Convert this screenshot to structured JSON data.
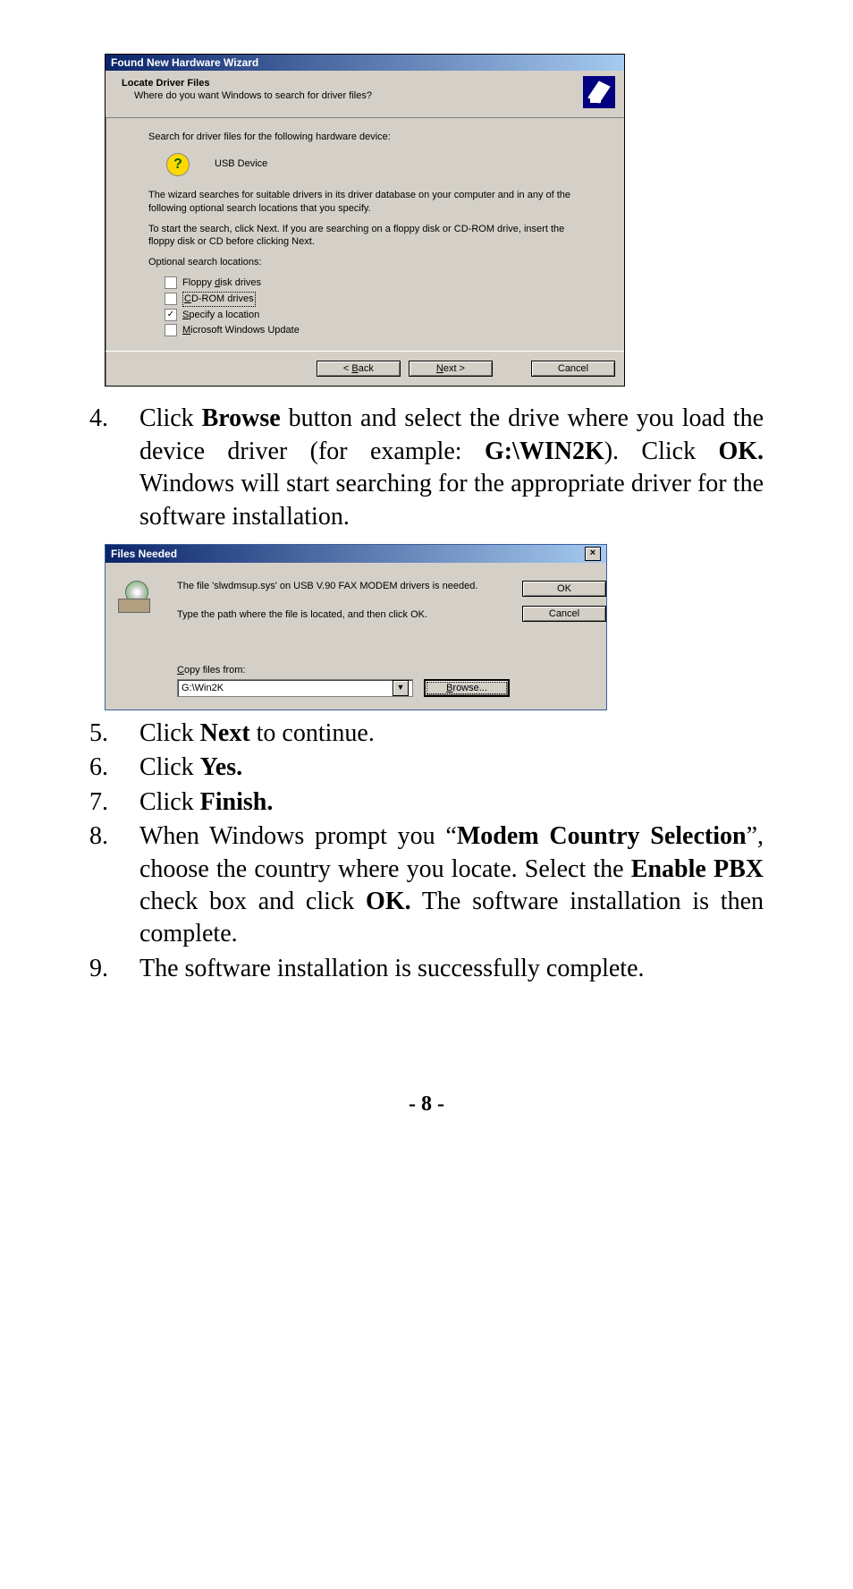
{
  "wizard": {
    "title": "Found New Hardware Wizard",
    "header_title": "Locate Driver Files",
    "header_sub": "Where do you want Windows to search for driver files?",
    "body": {
      "search_intro": "Search for driver files for the following hardware device:",
      "device_name": "USB Device",
      "para1": "The wizard searches for suitable drivers in its driver database on your computer and in any of the following optional search locations that you specify.",
      "para2": "To start the search, click Next. If you are searching on a floppy disk or CD-ROM drive, insert the floppy disk or CD before clicking Next.",
      "optional_label": "Optional search locations:",
      "options": {
        "floppy_pre": "Floppy ",
        "floppy_ul": "d",
        "floppy_post": "isk drives",
        "cdrom_ul": "C",
        "cdrom_post": "D-ROM drives",
        "specify_ul": "S",
        "specify_post": "pecify a location",
        "mwu_ul": "M",
        "mwu_post": "icrosoft Windows Update"
      }
    },
    "buttons": {
      "back_pre": "< ",
      "back_ul": "B",
      "back_post": "ack",
      "next_ul": "N",
      "next_post": "ext >",
      "cancel": "Cancel"
    }
  },
  "step4": {
    "num": "4.",
    "t1": "Click ",
    "b1": "Browse",
    "t2": " button and select the drive where you load the device driver (for example: ",
    "b2": "G:\\WIN2K",
    "t3": ").  Click ",
    "b3": "OK.",
    "t4": "  Windows will start searching for the appropriate driver for the software installation."
  },
  "files": {
    "title": "Files Needed",
    "msg": "The file 'slwdmsup.sys' on USB V.90 FAX MODEM drivers is needed.",
    "type_path": "Type the path where the file is located, and then click OK.",
    "copy_ul": "C",
    "copy_post": "opy files from:",
    "path_value": "G:\\Win2K",
    "ok": "OK",
    "cancel": "Cancel",
    "browse_ul": "B",
    "browse_post": "rowse..."
  },
  "step5": {
    "num": "5.",
    "t1": "Click ",
    "b1": "Next",
    "t2": " to continue."
  },
  "step6": {
    "num": "6.",
    "t1": "Click ",
    "b1": "Yes."
  },
  "step7": {
    "num": "7.",
    "t1": "Click ",
    "b1": "Finish."
  },
  "step8": {
    "num": "8.",
    "t1": "When Windows prompt you “",
    "b1": "Modem Country Selection",
    "t2": "”, choose the country where you locate. Select the ",
    "b2": "Enable PBX",
    "t3": " check box and click ",
    "b3": "OK.",
    "t4": " The software installation is then complete."
  },
  "step9": {
    "num": "9.",
    "t1": "The software installation is successfully complete."
  },
  "page_number": "- 8 -"
}
